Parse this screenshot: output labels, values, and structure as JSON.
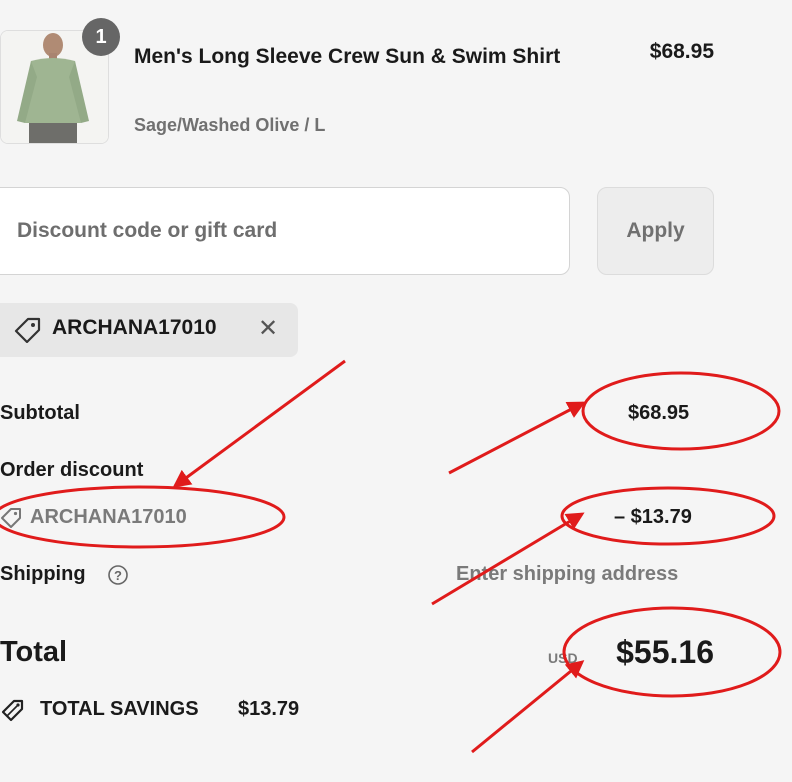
{
  "item": {
    "quantity": "1",
    "title": "Men's Long Sleeve Crew Sun & Swim Shirt",
    "variant": "Sage/Washed Olive / L",
    "price": "$68.95"
  },
  "discount": {
    "placeholder": "Discount code or gift card",
    "apply_label": "Apply",
    "applied_code": "ARCHANA17010",
    "remove_symbol": "✕"
  },
  "summary": {
    "subtotal_label": "Subtotal",
    "subtotal_value": "$68.95",
    "order_discount_label": "Order discount",
    "discount_code": "ARCHANA17010",
    "discount_value": "– $13.79",
    "shipping_label": "Shipping",
    "shipping_value": "Enter shipping address",
    "total_label": "Total",
    "currency": "USD",
    "total_value": "$55.16",
    "savings_label": "TOTAL SAVINGS",
    "savings_value": "$13.79"
  },
  "colors": {
    "annotation": "#e01b1b",
    "muted_text": "#707070",
    "background": "#f5f5f5"
  },
  "icons": [
    "tag-icon",
    "close-icon",
    "help-icon",
    "savings-tag-icon"
  ]
}
